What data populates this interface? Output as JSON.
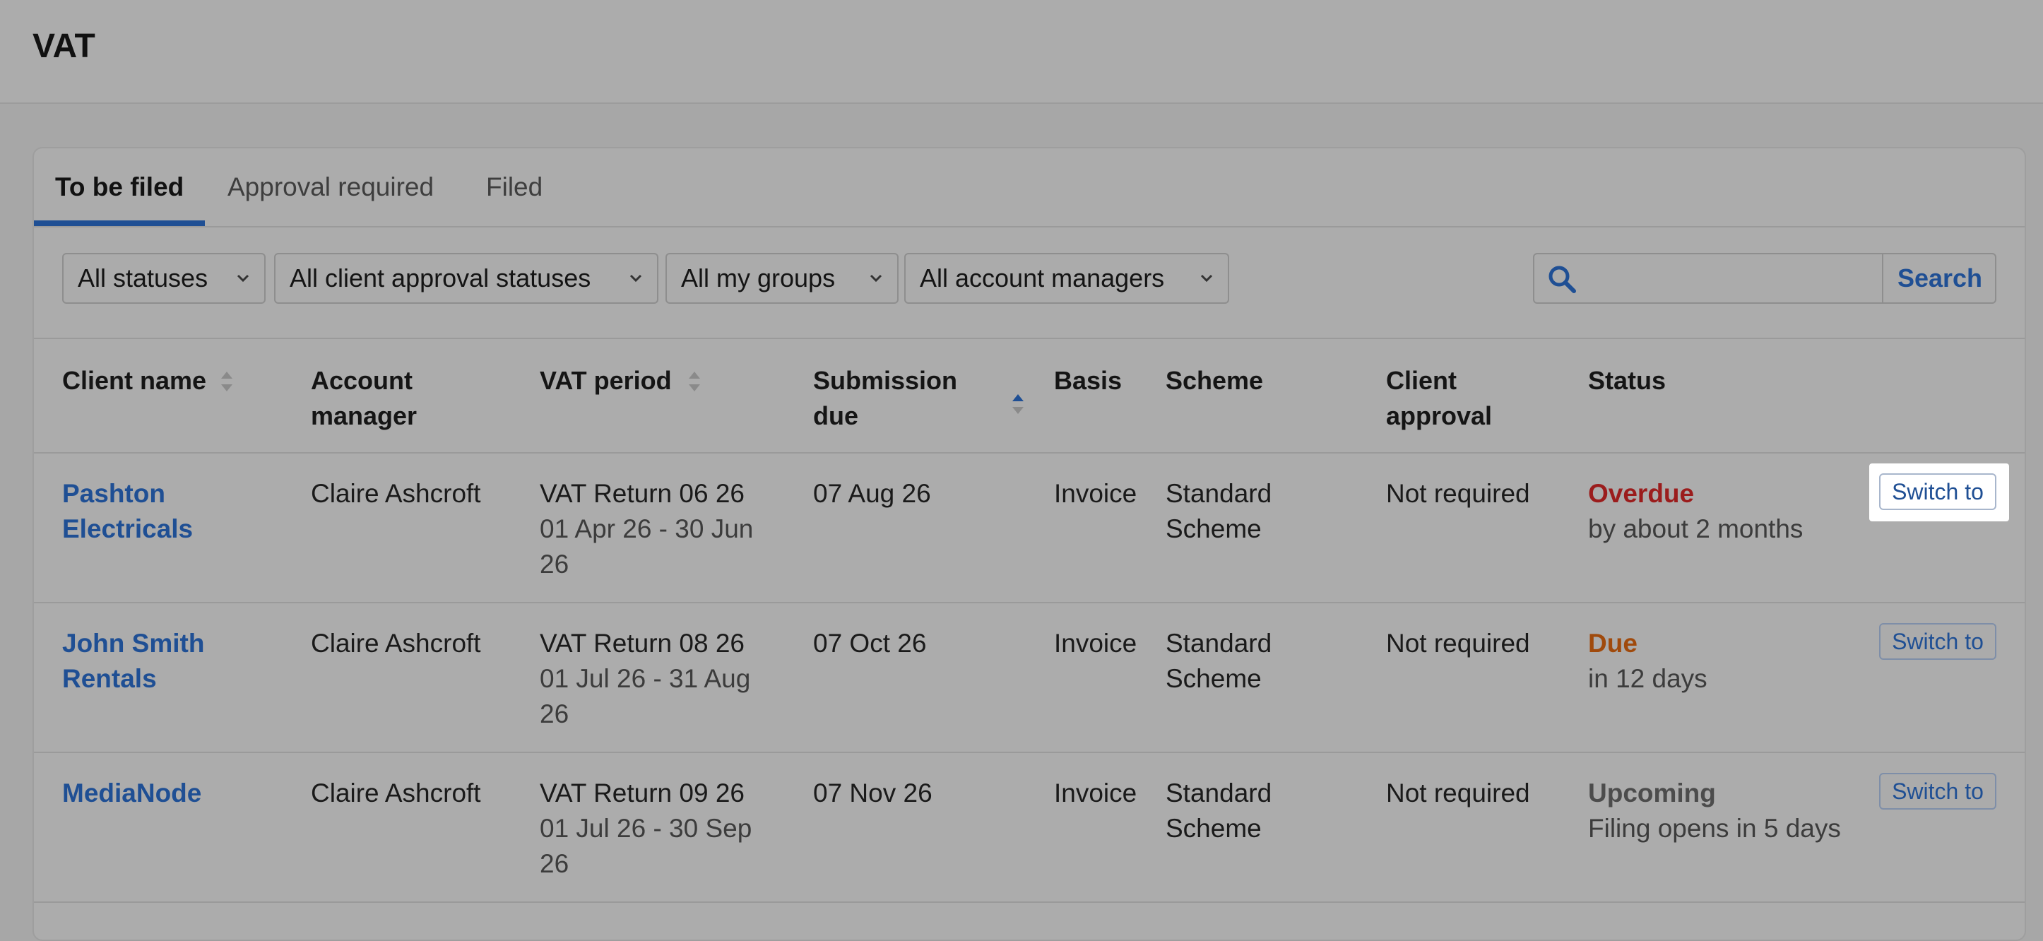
{
  "page": {
    "title": "VAT"
  },
  "tabs": [
    {
      "label": "To be filed",
      "active": true
    },
    {
      "label": "Approval required",
      "active": false
    },
    {
      "label": "Filed",
      "active": false
    }
  ],
  "filters": {
    "status": "All statuses",
    "client_approval": "All client approval statuses",
    "groups": "All my groups",
    "account_managers": "All account managers"
  },
  "search": {
    "placeholder": "",
    "button_label": "Search"
  },
  "table": {
    "headers": {
      "client_name": "Client name",
      "account_manager_line1": "Account",
      "account_manager_line2": "manager",
      "vat_period": "VAT period",
      "submission_line1": "Submission",
      "submission_line2": "due",
      "basis": "Basis",
      "scheme": "Scheme",
      "approval_line1": "Client",
      "approval_line2": "approval",
      "status": "Status"
    },
    "rows": [
      {
        "client_line1": "Pashton",
        "client_line2": "Electricals",
        "account_manager": "Claire Ashcroft",
        "return_name": "VAT Return 06 26",
        "period_line1": "01 Apr 26 - 30 Jun",
        "period_line2": "26",
        "submission_due": "07 Aug 26",
        "basis": "Invoice",
        "scheme_line1": "Standard",
        "scheme_line2": "Scheme",
        "client_approval": "Not required",
        "status": "Overdue",
        "status_detail": "by about 2 months",
        "action": "Switch to"
      },
      {
        "client_line1": "John Smith",
        "client_line2": "Rentals",
        "account_manager": "Claire Ashcroft",
        "return_name": "VAT Return 08 26",
        "period_line1": "01 Jul 26 - 31 Aug",
        "period_line2": "26",
        "submission_due": "07 Oct 26",
        "basis": "Invoice",
        "scheme_line1": "Standard",
        "scheme_line2": "Scheme",
        "client_approval": "Not required",
        "status": "Due",
        "status_detail": "in 12 days",
        "action": "Switch to"
      },
      {
        "client_line1": "MediaNode",
        "client_line2": "",
        "account_manager": "Claire Ashcroft",
        "return_name": "VAT Return 09 26",
        "period_line1": "01 Jul 26 - 30 Sep",
        "period_line2": "26",
        "submission_due": "07 Nov 26",
        "basis": "Invoice",
        "scheme_line1": "Standard",
        "scheme_line2": "Scheme",
        "client_approval": "Not required",
        "status": "Upcoming",
        "status_detail": "Filing opens in 5 days",
        "action": "Switch to"
      }
    ]
  },
  "colors": {
    "link": "#1f4f94",
    "overdue": "#9b1c1c",
    "due": "#a04a0c",
    "upcoming": "#4c4c4c"
  }
}
